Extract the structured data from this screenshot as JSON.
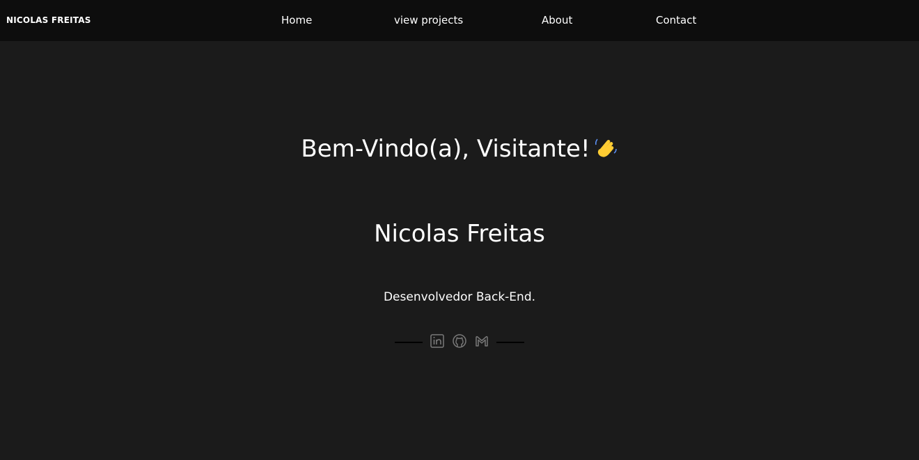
{
  "navbar": {
    "brand": "NICOLAS FREITAS",
    "links": [
      {
        "label": "Home"
      },
      {
        "label": "view projects"
      },
      {
        "label": "About"
      },
      {
        "label": "Contact"
      }
    ]
  },
  "hero": {
    "welcome": "Bem-Vindo(a), Visitante!",
    "welcome_emoji": "waving-hand-icon",
    "name": "Nicolas Freitas",
    "role": "Desenvolvedor Back-End."
  },
  "social": [
    {
      "icon": "linkedin-icon"
    },
    {
      "icon": "github-icon"
    },
    {
      "icon": "gmail-icon"
    }
  ],
  "colors": {
    "background": "#1b1b1b",
    "navbar": "#0d0d0d",
    "text": "#ffffff",
    "icon": "#7a7a7a"
  }
}
